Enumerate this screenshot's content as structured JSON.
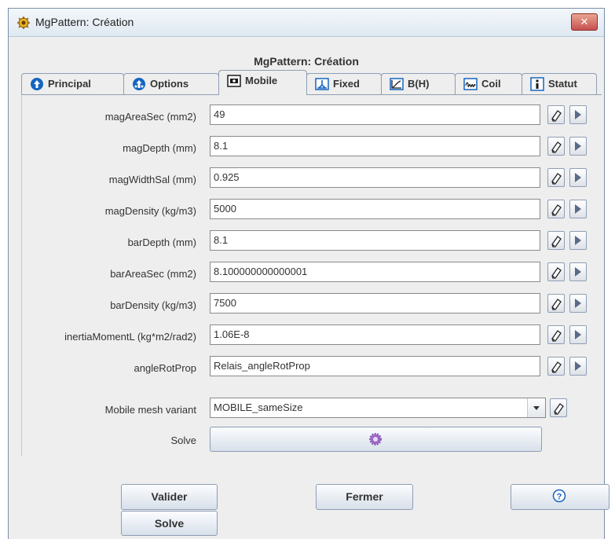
{
  "window": {
    "title": "MgPattern: Création"
  },
  "panel": {
    "title": "MgPattern: Création"
  },
  "tabs": [
    {
      "label": "Principal",
      "icon": "arrow-up-circle-icon"
    },
    {
      "label": "Options",
      "icon": "options-circle-icon"
    },
    {
      "label": "Mobile",
      "icon": "mobile-icon",
      "active": true
    },
    {
      "label": "Fixed",
      "icon": "fixed-icon"
    },
    {
      "label": "B(H)",
      "icon": "curve-icon"
    },
    {
      "label": "Coil",
      "icon": "coil-icon"
    },
    {
      "label": "Statut",
      "icon": "info-icon"
    }
  ],
  "fields": [
    {
      "label": "magAreaSec (mm2)",
      "value": "49"
    },
    {
      "label": "magDepth (mm)",
      "value": "8.1"
    },
    {
      "label": "magWidthSal (mm)",
      "value": "0.925"
    },
    {
      "label": "magDensity (kg/m3)",
      "value": "5000"
    },
    {
      "label": "barDepth (mm)",
      "value": "8.1"
    },
    {
      "label": "barAreaSec (mm2)",
      "value": "8.100000000000001"
    },
    {
      "label": "barDensity (kg/m3)",
      "value": "7500"
    },
    {
      "label": "inertiaMomentL (kg*m2/rad2)",
      "value": "1.06E-8"
    },
    {
      "label": "angleRotProp",
      "value": "Relais_angleRotProp"
    }
  ],
  "mesh": {
    "label": "Mobile mesh variant",
    "value": "MOBILE_sameSize"
  },
  "solve_row": {
    "label": "Solve"
  },
  "buttons": {
    "valider": "Valider",
    "fermer": "Fermer",
    "solve": "Solve"
  },
  "colors": {
    "accent": "#1565c0",
    "close": "#c75050",
    "border": "#8e9db5"
  }
}
